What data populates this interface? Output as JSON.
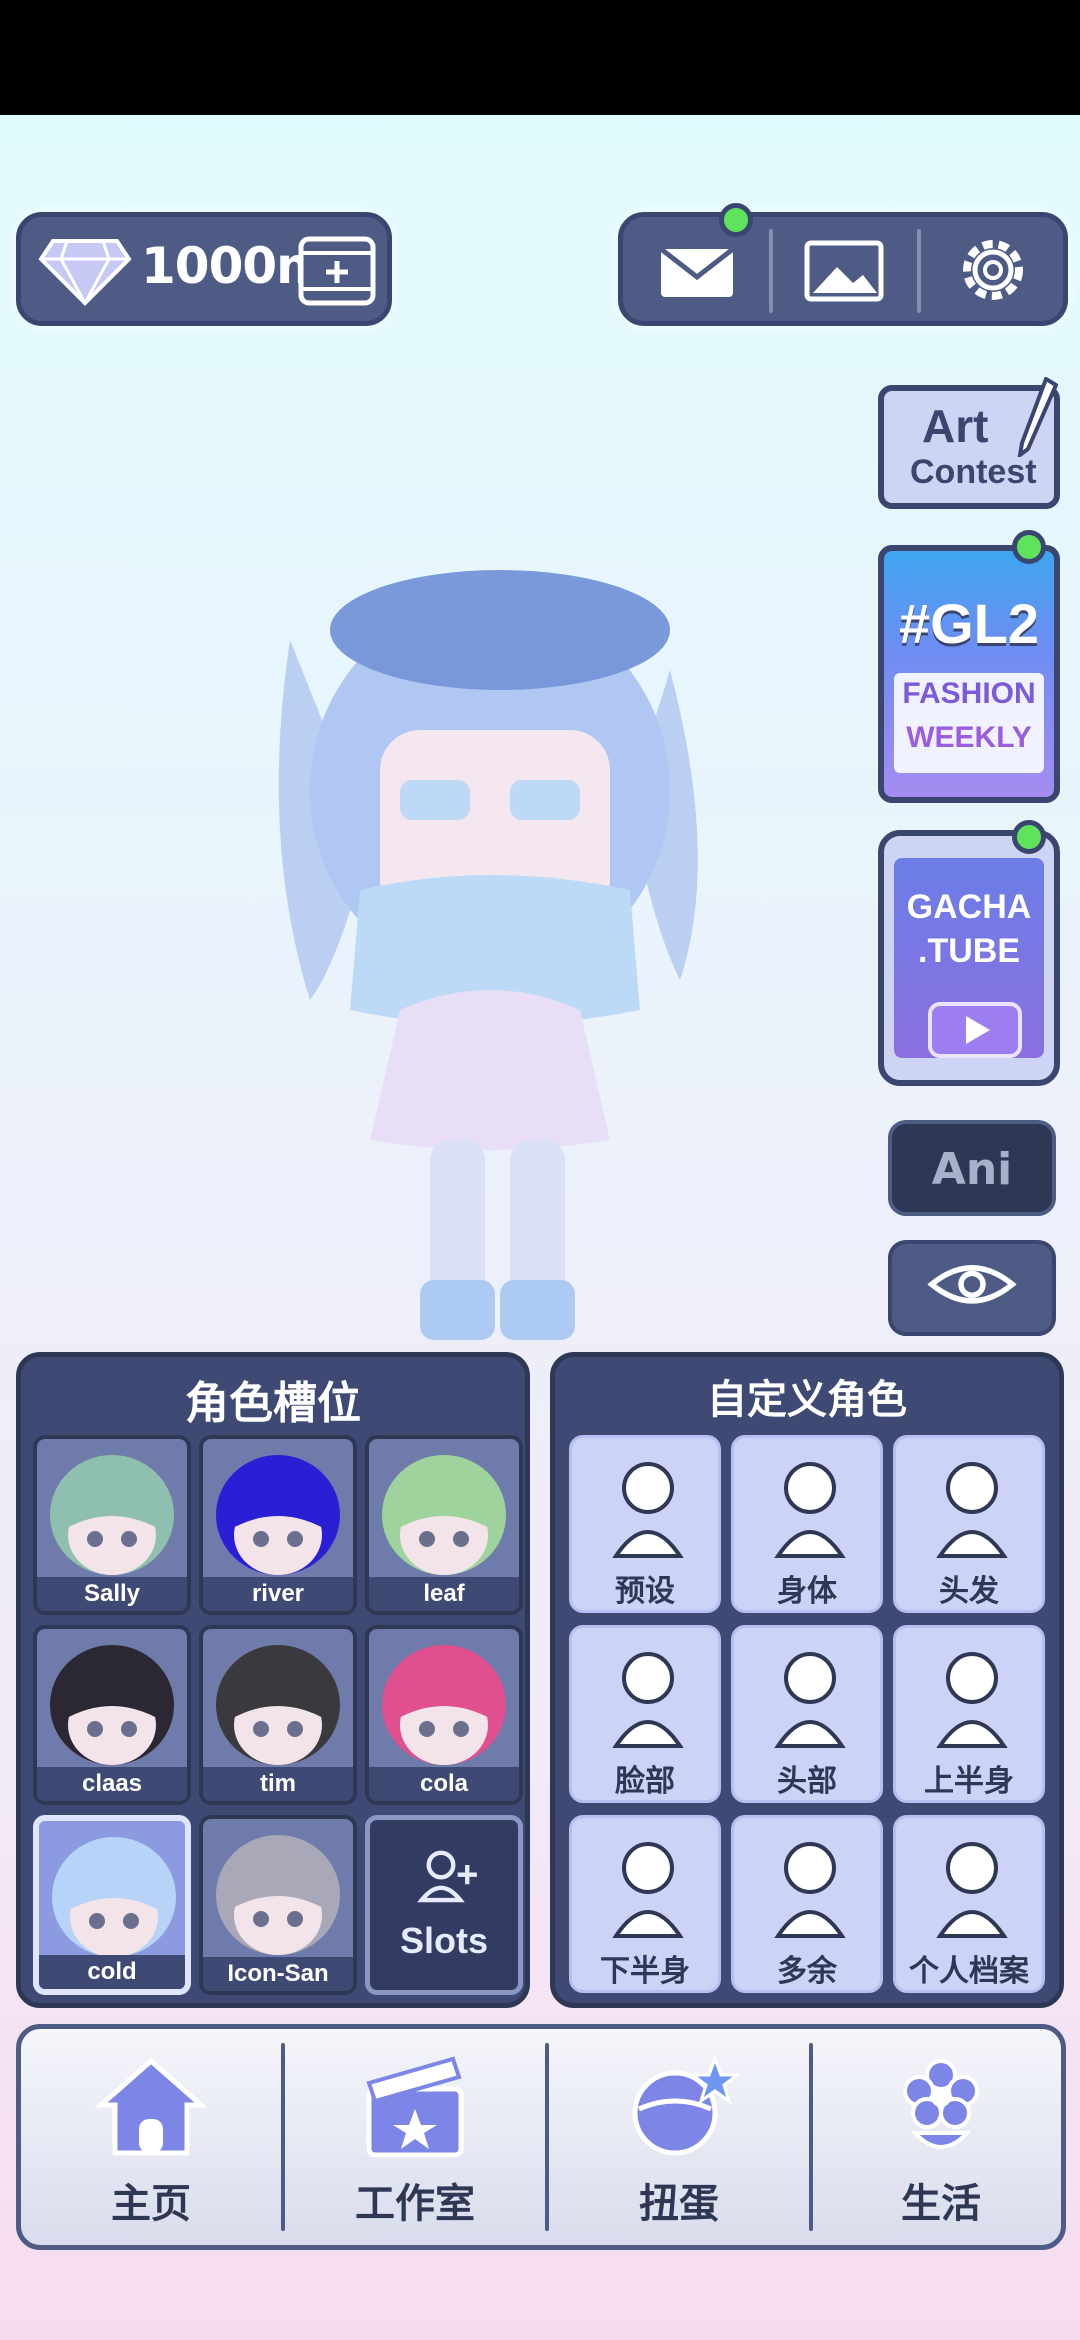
{
  "currency": {
    "value": "1000m",
    "icon": "diamond-icon",
    "add_icon": "film-plus-icon"
  },
  "toolbar": {
    "icons": [
      "mail-icon",
      "image-icon",
      "gear-icon"
    ]
  },
  "side": {
    "art_contest": {
      "line1": "Art",
      "line2": "Contest"
    },
    "gl2": {
      "tag": "#GL2",
      "line1": "FASHION",
      "line2": "WEEKLY"
    },
    "gacha_tube": {
      "line1": "GACHA",
      "line2": ".TUBE"
    },
    "ani_label": "Ani"
  },
  "slots_panel": {
    "title": "角色槽位",
    "slots": [
      {
        "name": "Sally",
        "hair": "#8fbfae"
      },
      {
        "name": "river",
        "hair": "#2b1fd6"
      },
      {
        "name": "leaf",
        "hair": "#9fd39d"
      },
      {
        "name": "claas",
        "hair": "#2b2733"
      },
      {
        "name": "tim",
        "hair": "#3a3a3e"
      },
      {
        "name": "cola",
        "hair": "#e0508f"
      },
      {
        "name": "cold",
        "hair": "#b7d3f7"
      },
      {
        "name": "Icon-San",
        "hair": "#a9a8b8"
      }
    ],
    "add_label": "Slots"
  },
  "custom_panel": {
    "title": "自定义角色",
    "categories": [
      {
        "label": "预设",
        "icon": "preset-icon"
      },
      {
        "label": "身体",
        "icon": "body-icon"
      },
      {
        "label": "头发",
        "icon": "hair-icon"
      },
      {
        "label": "脸部",
        "icon": "face-icon"
      },
      {
        "label": "头部",
        "icon": "head-accessory-icon"
      },
      {
        "label": "上半身",
        "icon": "upper-body-icon"
      },
      {
        "label": "下半身",
        "icon": "lower-body-icon"
      },
      {
        "label": "多余",
        "icon": "extra-icon"
      },
      {
        "label": "个人档案",
        "icon": "profile-icon"
      }
    ]
  },
  "nav": [
    {
      "label": "主页",
      "icon": "home-icon"
    },
    {
      "label": "工作室",
      "icon": "studio-icon"
    },
    {
      "label": "扭蛋",
      "icon": "gacha-icon"
    },
    {
      "label": "生活",
      "icon": "life-icon"
    }
  ],
  "colors": {
    "panel": "#3f4a74",
    "accent": "#60e35c",
    "card": "#cdd3f7"
  }
}
